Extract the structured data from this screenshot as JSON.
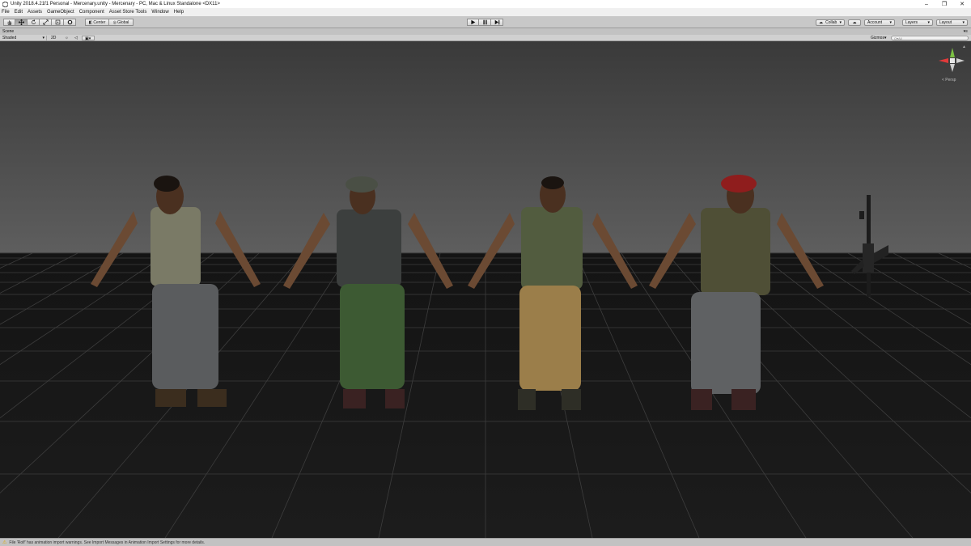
{
  "window": {
    "title": "Unity 2018.4.21f1 Personal - Mercenary.unity - Mercenary - PC, Mac & Linux Standalone <DX11>",
    "controls": [
      "–",
      "❐",
      "✕"
    ]
  },
  "menu": [
    "File",
    "Edit",
    "Assets",
    "GameObject",
    "Component",
    "Asset Store Tools",
    "Window",
    "Help"
  ],
  "toolbar": {
    "transform_tools": [
      "hand-icon",
      "move-icon",
      "rotate-icon",
      "scale-icon",
      "rect-icon",
      "transform-icon"
    ],
    "pivot_label": "Center",
    "space_label": "Global",
    "collab_label": "Collab",
    "account_label": "Account",
    "layers_label": "Layers",
    "layout_label": "Layout"
  },
  "scene": {
    "tab_label": "Scene",
    "shading_mode": "Shaded",
    "mode_2d": "2D",
    "gizmos_label": "Gizmos",
    "search_placeholder": "Q▾All",
    "persp_label": "< Persp"
  },
  "colors": {
    "berets": [
      "#4a4f45",
      "#8f1d1d"
    ],
    "pants": [
      "#5a5c5e",
      "#3d5a33",
      "#9b7e4a",
      "#5f6163"
    ]
  },
  "status": {
    "message": "File 'Rolf' has animation import warnings. See Import Messages in Animation Import Settings for more details."
  }
}
